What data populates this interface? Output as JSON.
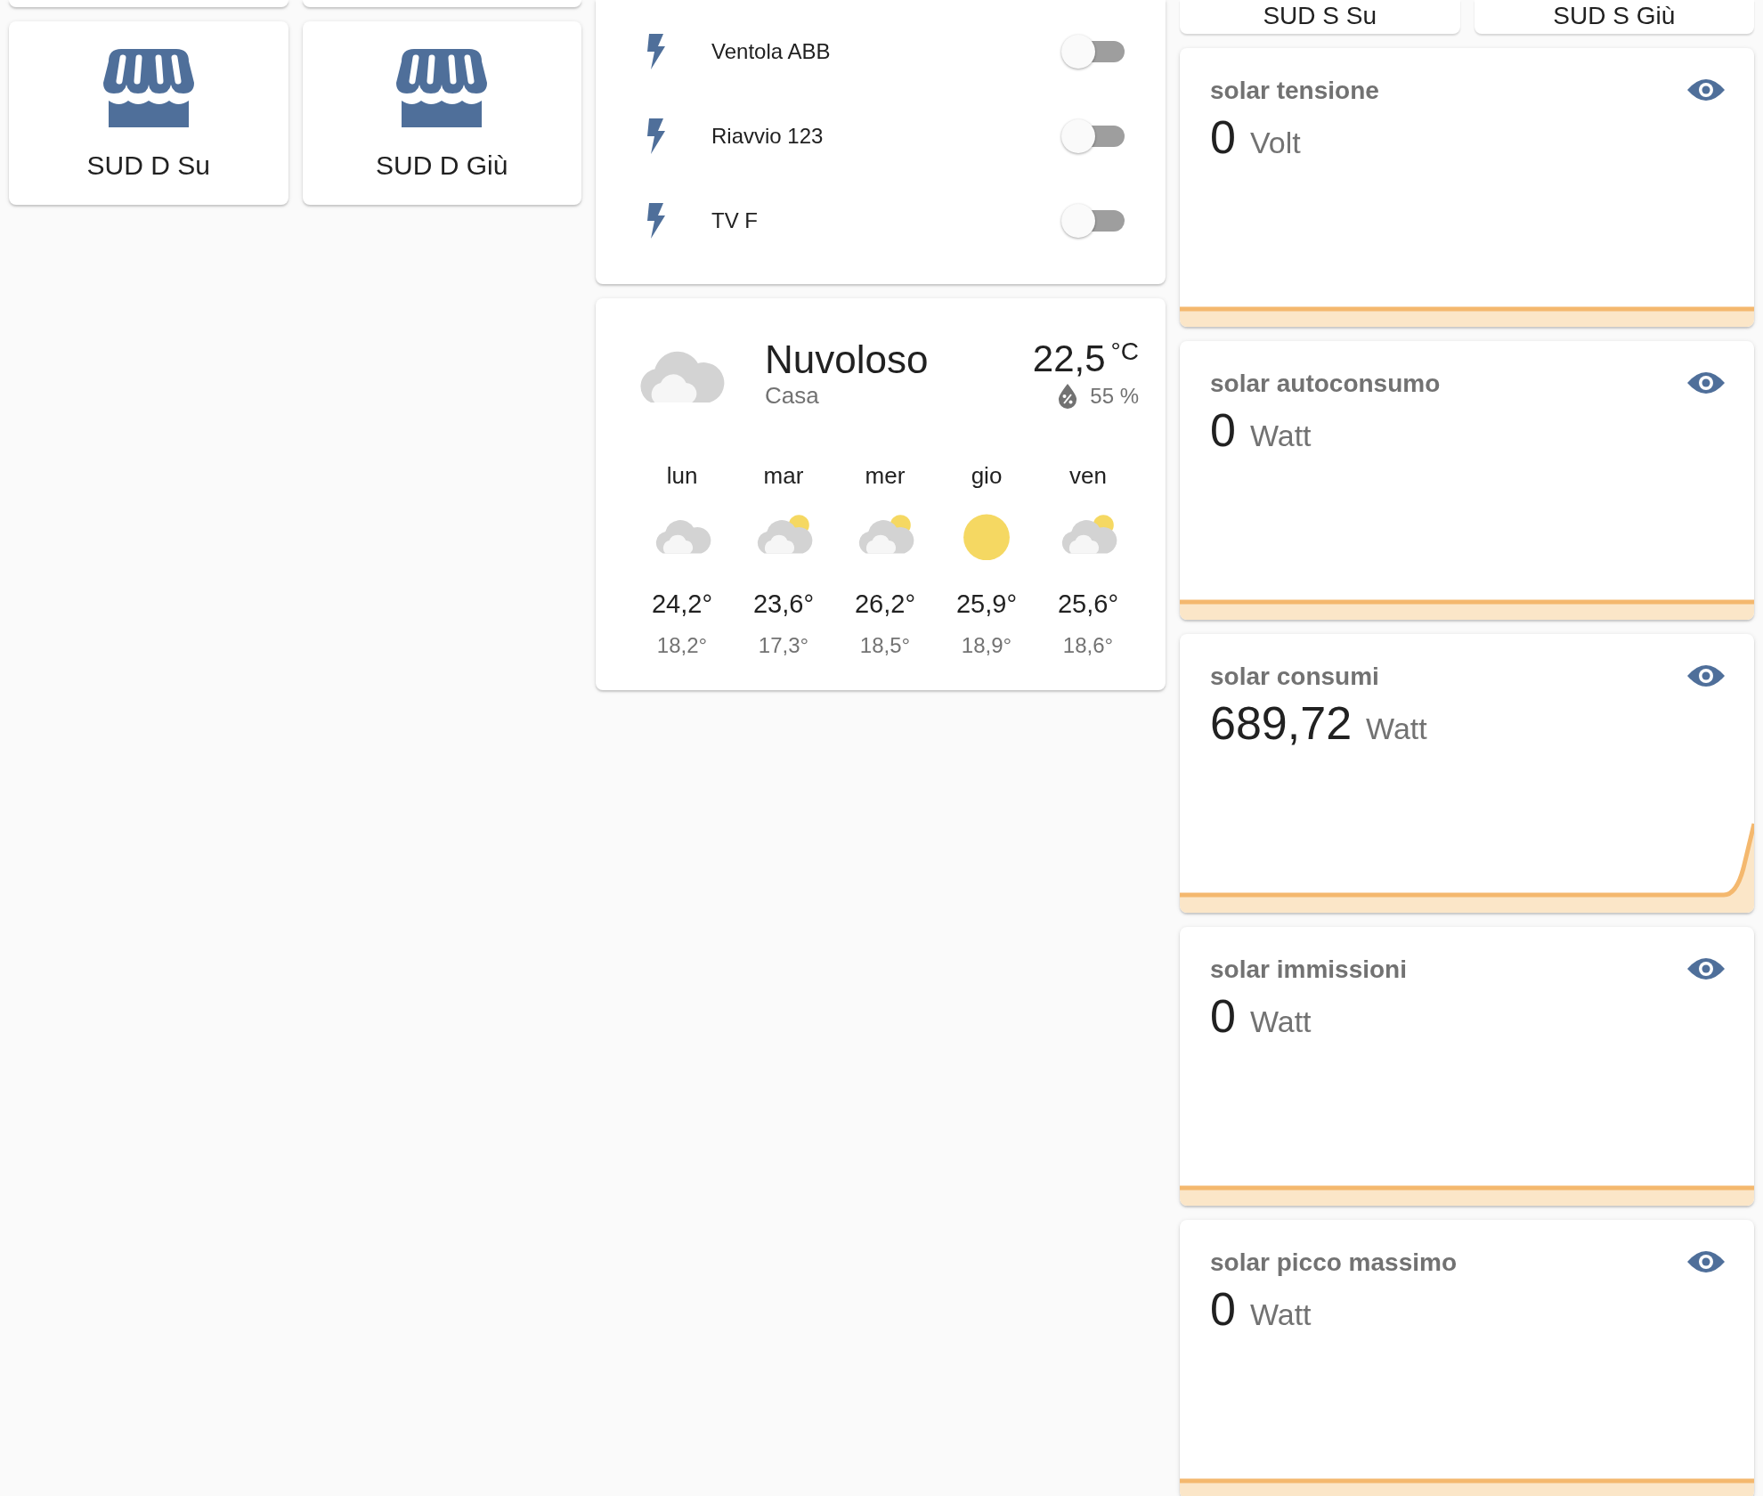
{
  "left_tiles": [
    {
      "label": "SUD D Su"
    },
    {
      "label": "SUD D Giù"
    }
  ],
  "switches": [
    {
      "label": "Ventola ABB",
      "on": false
    },
    {
      "label": "Riavvio 123",
      "on": false
    },
    {
      "label": "TV F",
      "on": false
    }
  ],
  "weather": {
    "condition": "Nuvoloso",
    "kind": "cloudy",
    "location": "Casa",
    "temperature": "22,5",
    "unit": "°C",
    "humidity": "55 %",
    "forecast": [
      {
        "day": "lun",
        "kind": "cloudy",
        "high": "24,2°",
        "low": "18,2°"
      },
      {
        "day": "mar",
        "kind": "partlycloudy",
        "high": "23,6°",
        "low": "17,3°"
      },
      {
        "day": "mer",
        "kind": "partlycloudy",
        "high": "26,2°",
        "low": "18,5°"
      },
      {
        "day": "gio",
        "kind": "sunny",
        "high": "25,9°",
        "low": "18,9°"
      },
      {
        "day": "ven",
        "kind": "partlycloudy",
        "high": "25,6°",
        "low": "18,6°"
      }
    ]
  },
  "right_buttons": [
    {
      "label": "SUD S Su"
    },
    {
      "label": "SUD S Giù"
    }
  ],
  "sensors": [
    {
      "name": "solar tensione",
      "value": "0",
      "unit": "Volt"
    },
    {
      "name": "solar autoconsumo",
      "value": "0",
      "unit": "Watt"
    },
    {
      "name": "solar consumi",
      "value": "689,72",
      "unit": "Watt"
    },
    {
      "name": "solar immissioni",
      "value": "0",
      "unit": "Watt"
    },
    {
      "name": "solar picco massimo",
      "value": "0",
      "unit": "Watt"
    }
  ]
}
